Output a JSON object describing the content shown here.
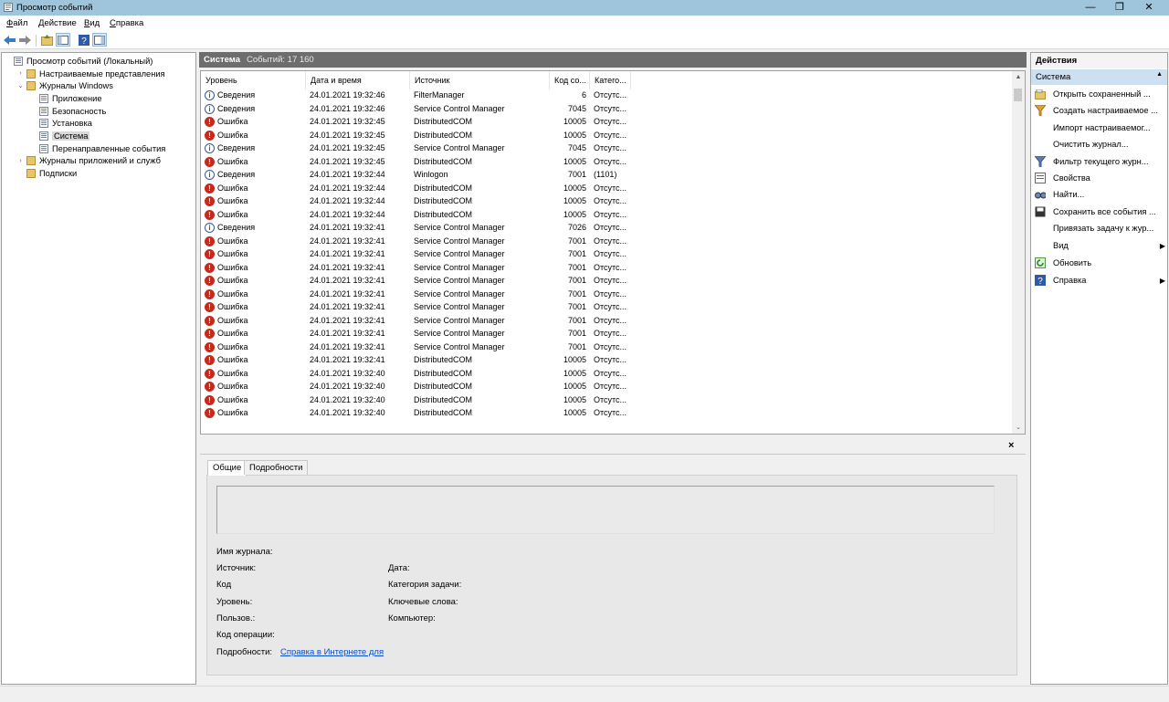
{
  "window": {
    "title": "Просмотр событий",
    "minimize": "—",
    "maximize": "❐",
    "close": "✕"
  },
  "menu": [
    {
      "label": "Файл",
      "hot": "Ф",
      "rest": "айл"
    },
    {
      "label": "Действие",
      "hot": "Д",
      "rest": "ействие"
    },
    {
      "label": "Вид",
      "hot": "В",
      "rest": "ид"
    },
    {
      "label": "Справка",
      "hot": "С",
      "rest": "правка"
    }
  ],
  "tree": [
    {
      "label": "Просмотр событий (Локальный)",
      "indent": 0,
      "arrow": "",
      "icon": "logic"
    },
    {
      "label": "Настраиваемые представления",
      "indent": 1,
      "arrow": "›",
      "icon": "folder"
    },
    {
      "label": "Журналы Windows",
      "indent": 1,
      "arrow": "⌄",
      "icon": "folder"
    },
    {
      "label": "Приложение",
      "indent": 2,
      "arrow": "",
      "icon": "logic"
    },
    {
      "label": "Безопасность",
      "indent": 2,
      "arrow": "",
      "icon": "logic"
    },
    {
      "label": "Установка",
      "indent": 2,
      "arrow": "",
      "icon": "logic"
    },
    {
      "label": "Система",
      "indent": 2,
      "arrow": "",
      "icon": "logic",
      "selected": true
    },
    {
      "label": "Перенаправленные события",
      "indent": 2,
      "arrow": "",
      "icon": "logic"
    },
    {
      "label": "Журналы приложений и служб",
      "indent": 1,
      "arrow": "›",
      "icon": "folder"
    },
    {
      "label": "Подписки",
      "indent": 1,
      "arrow": "",
      "icon": "folder"
    }
  ],
  "events_header": {
    "title": "Система",
    "count": "Событий: 17 160"
  },
  "columns": [
    "Уровень",
    "Дата и время",
    "Источник",
    "Код со...",
    "Катего..."
  ],
  "events": [
    {
      "level": "Сведения",
      "type": "info",
      "date": "24.01.2021 19:32:46",
      "source": "FilterManager",
      "code": "6",
      "cat": "Отсутс..."
    },
    {
      "level": "Сведения",
      "type": "info",
      "date": "24.01.2021 19:32:46",
      "source": "Service Control Manager",
      "code": "7045",
      "cat": "Отсутс..."
    },
    {
      "level": "Ошибка",
      "type": "err",
      "date": "24.01.2021 19:32:45",
      "source": "DistributedCOM",
      "code": "10005",
      "cat": "Отсутс..."
    },
    {
      "level": "Ошибка",
      "type": "err",
      "date": "24.01.2021 19:32:45",
      "source": "DistributedCOM",
      "code": "10005",
      "cat": "Отсутс..."
    },
    {
      "level": "Сведения",
      "type": "info",
      "date": "24.01.2021 19:32:45",
      "source": "Service Control Manager",
      "code": "7045",
      "cat": "Отсутс..."
    },
    {
      "level": "Ошибка",
      "type": "err",
      "date": "24.01.2021 19:32:45",
      "source": "DistributedCOM",
      "code": "10005",
      "cat": "Отсутс..."
    },
    {
      "level": "Сведения",
      "type": "info",
      "date": "24.01.2021 19:32:44",
      "source": "Winlogon",
      "code": "7001",
      "cat": "(1101)"
    },
    {
      "level": "Ошибка",
      "type": "err",
      "date": "24.01.2021 19:32:44",
      "source": "DistributedCOM",
      "code": "10005",
      "cat": "Отсутс..."
    },
    {
      "level": "Ошибка",
      "type": "err",
      "date": "24.01.2021 19:32:44",
      "source": "DistributedCOM",
      "code": "10005",
      "cat": "Отсутс..."
    },
    {
      "level": "Ошибка",
      "type": "err",
      "date": "24.01.2021 19:32:44",
      "source": "DistributedCOM",
      "code": "10005",
      "cat": "Отсутс..."
    },
    {
      "level": "Сведения",
      "type": "info",
      "date": "24.01.2021 19:32:41",
      "source": "Service Control Manager",
      "code": "7026",
      "cat": "Отсутс..."
    },
    {
      "level": "Ошибка",
      "type": "err",
      "date": "24.01.2021 19:32:41",
      "source": "Service Control Manager",
      "code": "7001",
      "cat": "Отсутс..."
    },
    {
      "level": "Ошибка",
      "type": "err",
      "date": "24.01.2021 19:32:41",
      "source": "Service Control Manager",
      "code": "7001",
      "cat": "Отсутс..."
    },
    {
      "level": "Ошибка",
      "type": "err",
      "date": "24.01.2021 19:32:41",
      "source": "Service Control Manager",
      "code": "7001",
      "cat": "Отсутс..."
    },
    {
      "level": "Ошибка",
      "type": "err",
      "date": "24.01.2021 19:32:41",
      "source": "Service Control Manager",
      "code": "7001",
      "cat": "Отсутс..."
    },
    {
      "level": "Ошибка",
      "type": "err",
      "date": "24.01.2021 19:32:41",
      "source": "Service Control Manager",
      "code": "7001",
      "cat": "Отсутс..."
    },
    {
      "level": "Ошибка",
      "type": "err",
      "date": "24.01.2021 19:32:41",
      "source": "Service Control Manager",
      "code": "7001",
      "cat": "Отсутс..."
    },
    {
      "level": "Ошибка",
      "type": "err",
      "date": "24.01.2021 19:32:41",
      "source": "Service Control Manager",
      "code": "7001",
      "cat": "Отсутс..."
    },
    {
      "level": "Ошибка",
      "type": "err",
      "date": "24.01.2021 19:32:41",
      "source": "Service Control Manager",
      "code": "7001",
      "cat": "Отсутс..."
    },
    {
      "level": "Ошибка",
      "type": "err",
      "date": "24.01.2021 19:32:41",
      "source": "Service Control Manager",
      "code": "7001",
      "cat": "Отсутс..."
    },
    {
      "level": "Ошибка",
      "type": "err",
      "date": "24.01.2021 19:32:41",
      "source": "DistributedCOM",
      "code": "10005",
      "cat": "Отсутс..."
    },
    {
      "level": "Ошибка",
      "type": "err",
      "date": "24.01.2021 19:32:40",
      "source": "DistributedCOM",
      "code": "10005",
      "cat": "Отсутс..."
    },
    {
      "level": "Ошибка",
      "type": "err",
      "date": "24.01.2021 19:32:40",
      "source": "DistributedCOM",
      "code": "10005",
      "cat": "Отсутс..."
    },
    {
      "level": "Ошибка",
      "type": "err",
      "date": "24.01.2021 19:32:40",
      "source": "DistributedCOM",
      "code": "10005",
      "cat": "Отсутс..."
    },
    {
      "level": "Ошибка",
      "type": "err",
      "date": "24.01.2021 19:32:40",
      "source": "DistributedCOM",
      "code": "10005",
      "cat": "Отсутс..."
    }
  ],
  "details": {
    "tabs": [
      "Общие",
      "Подробности"
    ],
    "fields": {
      "log_name": "Имя журнала:",
      "source": "Источник:",
      "code": "Код",
      "level": "Уровень:",
      "user": "Пользов.:",
      "opcode": "Код операции:",
      "more": "Подробности:",
      "date": "Дата:",
      "task_category": "Категория задачи:",
      "keywords": "Ключевые слова:",
      "computer": "Компьютер:"
    },
    "help_link": "Справка в Интернете для",
    "close": "×"
  },
  "actions": {
    "title": "Действия",
    "section": "Система",
    "items": [
      {
        "label": "Открыть сохраненный ...",
        "icon": "open"
      },
      {
        "label": "Создать настраиваемое ...",
        "icon": "filter"
      },
      {
        "label": "Импорт настраиваемог...",
        "icon": ""
      },
      {
        "label": "Очистить журнал...",
        "icon": ""
      },
      {
        "label": "Фильтр текущего журн...",
        "icon": "filter2"
      },
      {
        "label": "Свойства",
        "icon": "props"
      },
      {
        "label": "Найти...",
        "icon": "find"
      },
      {
        "label": "Сохранить все события ...",
        "icon": "save"
      },
      {
        "label": "Привязать задачу к жур...",
        "icon": ""
      },
      {
        "label": "Вид",
        "icon": "",
        "submenu": true
      },
      {
        "label": "Обновить",
        "icon": "refresh"
      },
      {
        "label": "Справка",
        "icon": "help",
        "submenu": true
      }
    ]
  },
  "colors": {
    "titlebar": "#9fc5dc",
    "error": "#c42b1c",
    "info": "#3d5a8a",
    "section": "#cde0f2",
    "header": "#6d6d6d",
    "link": "#0b4fc5"
  }
}
